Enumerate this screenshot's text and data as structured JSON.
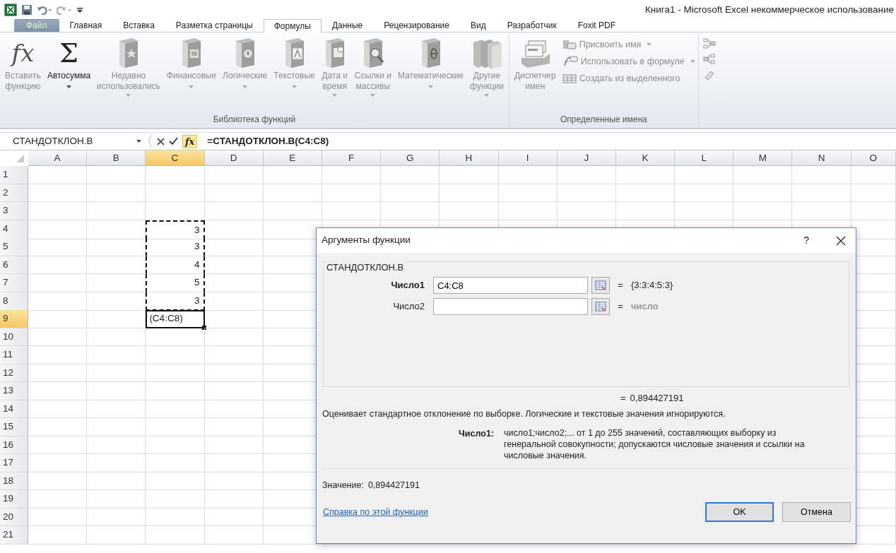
{
  "window": {
    "title": "Книга1  -  Microsoft Excel некоммерческое использование"
  },
  "tabs": [
    {
      "label": "Файл",
      "kind": "file",
      "selected": false
    },
    {
      "label": "Главная",
      "kind": "normal",
      "selected": false
    },
    {
      "label": "Вставка",
      "kind": "normal",
      "selected": false
    },
    {
      "label": "Разметка страницы",
      "kind": "normal",
      "selected": false
    },
    {
      "label": "Формулы",
      "kind": "normal",
      "selected": true
    },
    {
      "label": "Данные",
      "kind": "normal",
      "selected": false
    },
    {
      "label": "Рецензирование",
      "kind": "normal",
      "selected": false
    },
    {
      "label": "Вид",
      "kind": "normal",
      "selected": false
    },
    {
      "label": "Разработчик",
      "kind": "normal",
      "selected": false
    },
    {
      "label": "Foxit PDF",
      "kind": "normal",
      "selected": false
    }
  ],
  "ribbon": {
    "groups": [
      {
        "label": "Библиотека функций",
        "items": [
          {
            "kind": "large",
            "symbol": "fx",
            "label": "Вставить\nфункцию",
            "disabled": true,
            "dropdown": false
          },
          {
            "kind": "large",
            "symbol": "Σ",
            "label": "Автосумма",
            "disabled": false,
            "dropdown": true
          },
          {
            "kind": "large",
            "label": "Недавно\nиспользовались",
            "disabled": true,
            "dropdown": true
          },
          {
            "kind": "large",
            "label": "Финансовые",
            "disabled": true,
            "dropdown": true
          },
          {
            "kind": "large",
            "label": "Логические",
            "disabled": true,
            "dropdown": true
          },
          {
            "kind": "large",
            "label": "Текстовые",
            "disabled": true,
            "dropdown": true
          },
          {
            "kind": "large",
            "label": "Дата и\nвремя",
            "disabled": true,
            "dropdown": true
          },
          {
            "kind": "large",
            "label": "Ссылки и\nмассивы",
            "disabled": true,
            "dropdown": true
          },
          {
            "kind": "large",
            "label": "Математические",
            "disabled": true,
            "dropdown": true
          },
          {
            "kind": "large",
            "label": "Другие\nфункции",
            "disabled": true,
            "dropdown": true
          }
        ]
      },
      {
        "label": "Определенные имена",
        "items": [
          {
            "kind": "large",
            "label": "Диспетчер\nимен",
            "disabled": true,
            "dropdown": false
          },
          {
            "kind": "small",
            "label": "Присвоить имя",
            "disabled": true,
            "dropdown": true
          },
          {
            "kind": "small",
            "label": "Использовать в формуле",
            "disabled": true,
            "dropdown": true
          },
          {
            "kind": "small",
            "label": "Создать из выделенного",
            "disabled": true,
            "dropdown": false
          }
        ]
      }
    ]
  },
  "formula_bar": {
    "name_box": "СТАНДОТКЛОН.В",
    "fx_label": "fx",
    "formula": "=СТАНДОТКЛОН.В(C4:C8)"
  },
  "sheet": {
    "columns": [
      {
        "label": "A",
        "selected": false
      },
      {
        "label": "B",
        "selected": false
      },
      {
        "label": "C",
        "selected": true
      },
      {
        "label": "D",
        "selected": false
      },
      {
        "label": "E",
        "selected": false
      },
      {
        "label": "F",
        "selected": false
      },
      {
        "label": "G",
        "selected": false
      },
      {
        "label": "H",
        "selected": false
      },
      {
        "label": "I",
        "selected": false
      },
      {
        "label": "J",
        "selected": false
      },
      {
        "label": "K",
        "selected": false
      },
      {
        "label": "L",
        "selected": false
      },
      {
        "label": "M",
        "selected": false
      },
      {
        "label": "N",
        "selected": false
      },
      {
        "label": "O",
        "selected": false
      }
    ],
    "rows": [
      {
        "label": "1",
        "selected": false,
        "cells": []
      },
      {
        "label": "2",
        "selected": false,
        "cells": []
      },
      {
        "label": "3",
        "selected": false,
        "cells": []
      },
      {
        "label": "4",
        "selected": false,
        "cells": [
          {
            "text": "",
            "kind": "empty",
            "in_range": false,
            "active": false
          },
          {
            "text": "",
            "kind": "empty",
            "in_range": false,
            "active": false
          },
          {
            "text": "3",
            "kind": "number",
            "in_range": true,
            "active": false
          }
        ]
      },
      {
        "label": "5",
        "selected": false,
        "cells": [
          {
            "text": "",
            "kind": "empty",
            "in_range": false,
            "active": false
          },
          {
            "text": "",
            "kind": "empty",
            "in_range": false,
            "active": false
          },
          {
            "text": "3",
            "kind": "number",
            "in_range": true,
            "active": false
          }
        ]
      },
      {
        "label": "6",
        "selected": false,
        "cells": [
          {
            "text": "",
            "kind": "empty",
            "in_range": false,
            "active": false
          },
          {
            "text": "",
            "kind": "empty",
            "in_range": false,
            "active": false
          },
          {
            "text": "4",
            "kind": "number",
            "in_range": true,
            "active": false
          }
        ]
      },
      {
        "label": "7",
        "selected": false,
        "cells": [
          {
            "text": "",
            "kind": "empty",
            "in_range": false,
            "active": false
          },
          {
            "text": "",
            "kind": "empty",
            "in_range": false,
            "active": false
          },
          {
            "text": "5",
            "kind": "number",
            "in_range": true,
            "active": false
          }
        ]
      },
      {
        "label": "8",
        "selected": false,
        "cells": [
          {
            "text": "",
            "kind": "empty",
            "in_range": false,
            "active": false
          },
          {
            "text": "",
            "kind": "empty",
            "in_range": false,
            "active": false
          },
          {
            "text": "3",
            "kind": "number",
            "in_range": true,
            "active": false
          }
        ]
      },
      {
        "label": "9",
        "selected": true,
        "cells": [
          {
            "text": "",
            "kind": "empty",
            "in_range": false,
            "active": false
          },
          {
            "text": "",
            "kind": "empty",
            "in_range": false,
            "active": false
          },
          {
            "text": "(C4:C8)",
            "kind": "text",
            "in_range": false,
            "active": true
          }
        ]
      },
      {
        "label": "10",
        "selected": false,
        "cells": []
      },
      {
        "label": "11",
        "selected": false,
        "cells": []
      },
      {
        "label": "12",
        "selected": false,
        "cells": []
      },
      {
        "label": "13",
        "selected": false,
        "cells": []
      },
      {
        "label": "14",
        "selected": false,
        "cells": []
      },
      {
        "label": "15",
        "selected": false,
        "cells": []
      },
      {
        "label": "16",
        "selected": false,
        "cells": []
      },
      {
        "label": "17",
        "selected": false,
        "cells": []
      },
      {
        "label": "18",
        "selected": false,
        "cells": []
      },
      {
        "label": "19",
        "selected": false,
        "cells": []
      },
      {
        "label": "20",
        "selected": false,
        "cells": []
      },
      {
        "label": "21",
        "selected": false,
        "cells": []
      }
    ]
  },
  "dialog": {
    "title": "Аргументы функции",
    "help": "?",
    "function_name": "СТАНДОТКЛОН.В",
    "arguments": [
      {
        "label": "Число1",
        "selected": true,
        "value": "C4:C8",
        "equals": "=",
        "result": "{3:3:4:5:3}",
        "result_muted": false
      },
      {
        "label": "Число2",
        "selected": false,
        "equals": "=",
        "result": "число",
        "result_muted": true
      }
    ],
    "formula_result": {
      "equals": "=",
      "value": "0,894427191"
    },
    "description": "Оценивает стандартное отклонение по выборке. Логические и текстовые значения игнорируются.",
    "argument_help": {
      "label": "Число1:",
      "text": "число1;число2;... от 1 до 255 значений, составляющих выборку из генеральной совокупности; допускаются числовые значения и ссылки на числовые значения."
    },
    "value_label": "Значение:",
    "value": "0,894427191",
    "help_link": "Справка по этой функции",
    "buttons": [
      {
        "label": "OK",
        "default": true
      },
      {
        "label": "Отмена",
        "default": false
      }
    ]
  }
}
